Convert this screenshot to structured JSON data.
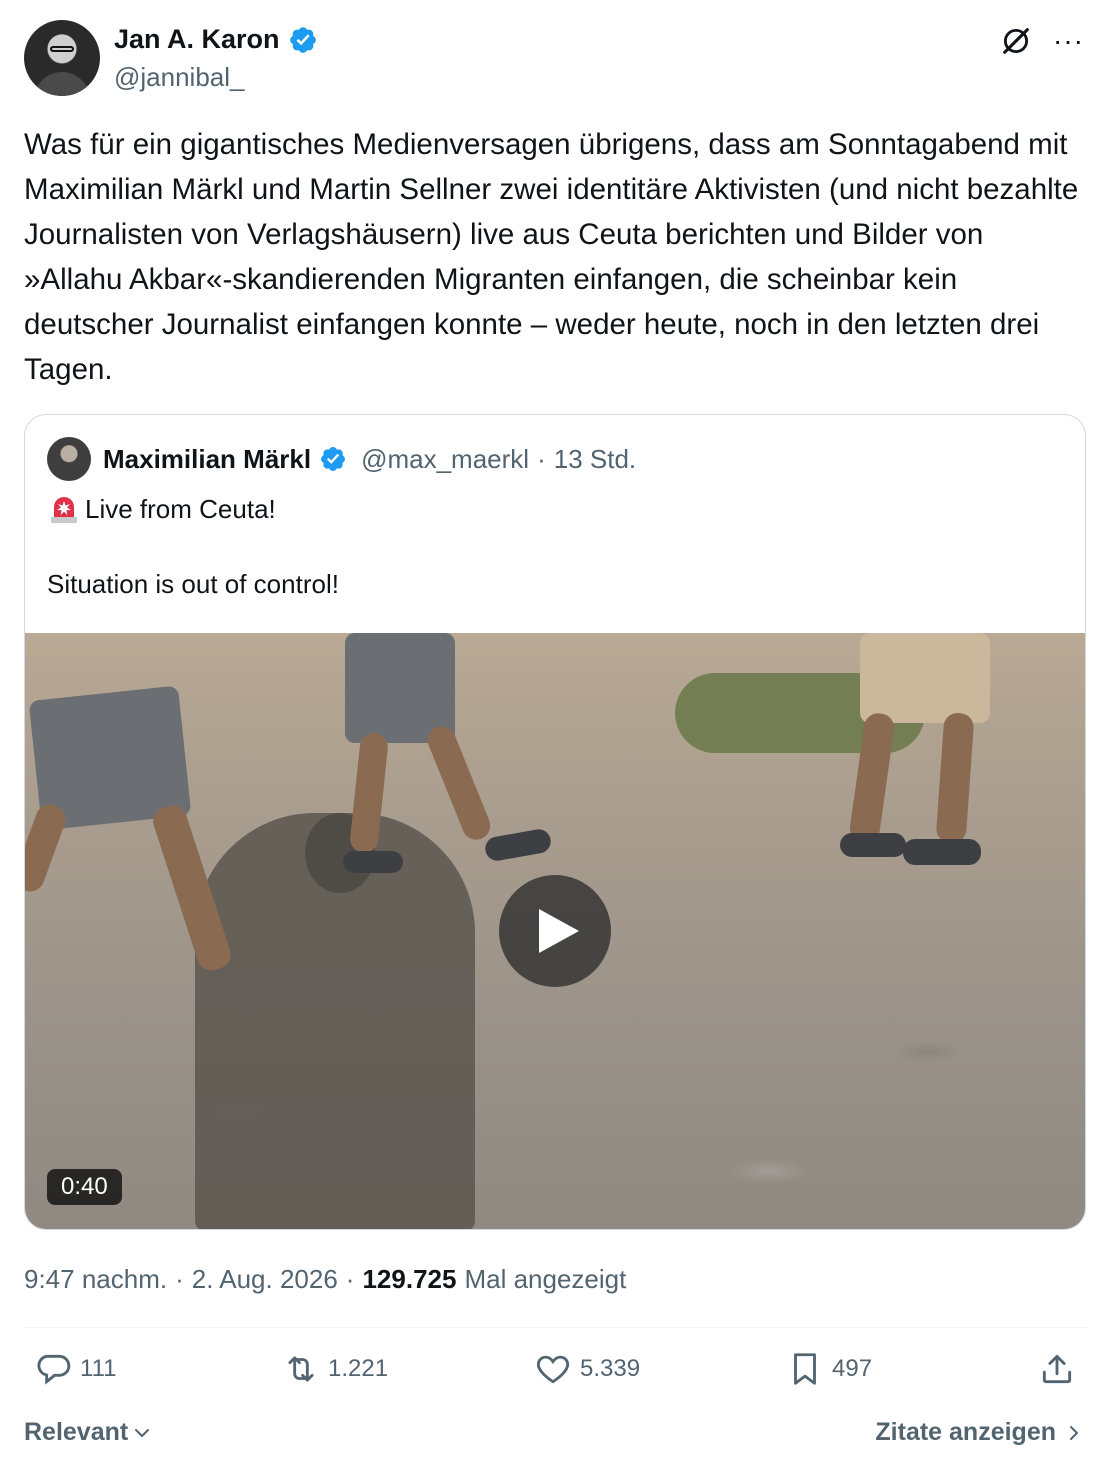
{
  "author": {
    "name": "Jan A. Karon",
    "handle": "@jannibal_"
  },
  "tweet": {
    "text": "Was für ein gigantisches Medienversagen übrigens, dass am Sonntagabend mit Maximilian Märkl und Martin Sellner zwei identitäre Aktivisten (und nicht bezahlte Journalisten von Verlagshäusern) live aus Ceuta berichten und Bilder von »Allahu Akbar«-skandierenden Migranten einfangen, die scheinbar kein deutscher Journalist einfangen konnte – weder heute, noch in den letzten drei Tagen."
  },
  "quote": {
    "name": "Maximilian Märkl",
    "handle": "@max_maerkl",
    "separator": "·",
    "time": "13 Std.",
    "line1": "Live from Ceuta!",
    "line2": "Situation is out of control!",
    "video_duration": "0:40"
  },
  "meta": {
    "time": "9:47 nachm.",
    "sep1": "·",
    "date": "2. Aug. 2026",
    "sep2": "·",
    "views": "129.725",
    "views_label": "Mal angezeigt"
  },
  "actions": {
    "replies": "111",
    "reposts": "1.221",
    "likes": "5.339",
    "bookmarks": "497"
  },
  "footer": {
    "sort_label": "Relevant",
    "quotes_label": "Zitate anzeigen"
  },
  "colors": {
    "verified": "#1d9bf0",
    "secondary_text": "#536471",
    "primary_text": "#0f1419",
    "border": "#cfd9de"
  }
}
